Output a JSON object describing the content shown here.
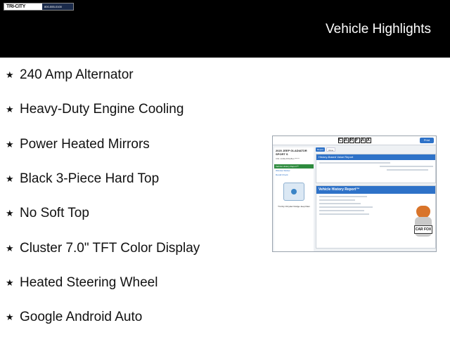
{
  "header": {
    "logo_text": "TRI-CITY",
    "logo_sub": "800-555-0100",
    "title": "Vehicle Highlights"
  },
  "features": [
    "240 Amp Alternator",
    "Heavy-Duty Engine Cooling",
    "Power Heated Mirrors",
    "Black 3-Piece Hard Top",
    "No Soft Top",
    "Cluster 7.0\" TFT Color Display",
    "Heated Steering Wheel",
    "Google Android Auto"
  ],
  "carfax": {
    "print_label": "Print",
    "vehicle": "2020 JEEP GLADIATOR SPORT S",
    "vin": "VIN: 1C6HJTAG5LL******",
    "nav": [
      "Vehicle History Report™",
      "Window Sticker",
      "Recall Check"
    ],
    "tabs": [
      "Report",
      "Value"
    ],
    "card1_title": "History-Based Value Report",
    "card2_title": "Vehicle History Report™",
    "fox_sign": "CAR FOX",
    "dealer": "Tri-City Chrysler Dodge Jeep Ram",
    "colors": {
      "brand": "#2e72c8",
      "nav_active": "#2e8b3e",
      "fox": "#d9742a"
    }
  }
}
